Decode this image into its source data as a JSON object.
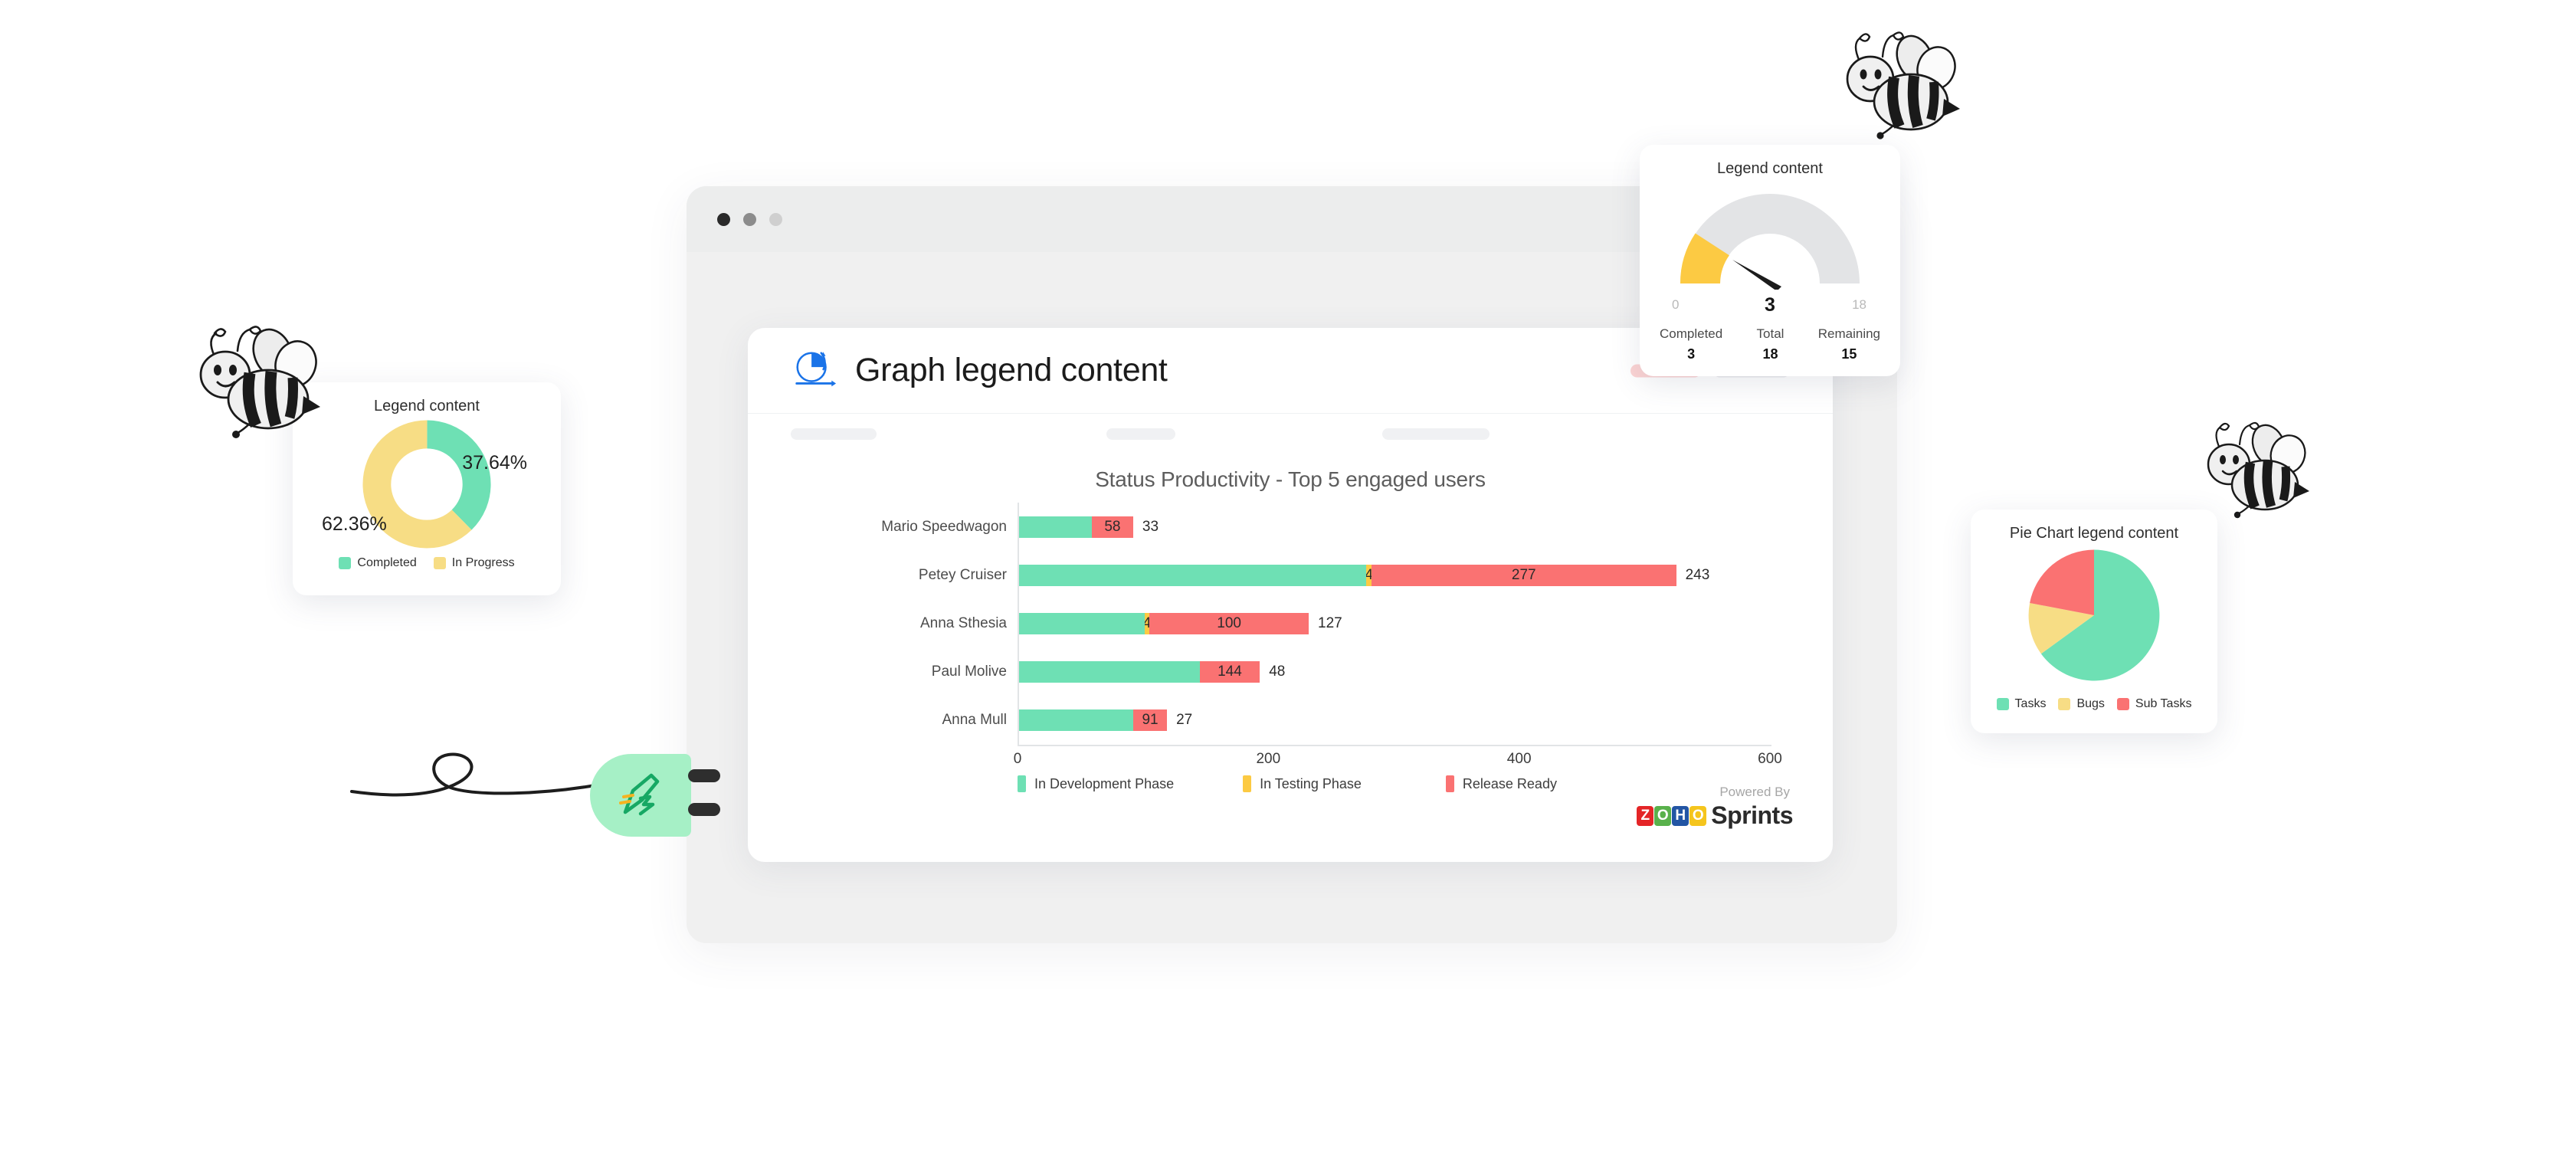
{
  "browser": {
    "dots": [
      "window-dot-close",
      "window-dot-minimize",
      "window-dot-maximize"
    ]
  },
  "dashboard": {
    "logo_icon": "pie-chart-refresh-icon",
    "title": "Graph legend content",
    "header_skeletons": [
      "skeleton-pill-pink",
      "skeleton-pill-gray"
    ],
    "subheader_skeletons": [
      "skeleton-bar-1",
      "skeleton-bar-2",
      "skeleton-bar-3"
    ],
    "powered_by": {
      "label": "Powered By",
      "brand_blocks": [
        "Z",
        "O",
        "H",
        "O"
      ],
      "brand_word": "Sprints"
    }
  },
  "chart_data": {
    "type": "bar",
    "orientation": "horizontal",
    "stacked": true,
    "title": "Status Productivity - Top 5 engaged users",
    "xlabel": "",
    "ylabel": "",
    "xlim": [
      0,
      600
    ],
    "xticks": [
      0,
      200,
      400,
      600
    ],
    "grid": false,
    "legend_position": "bottom",
    "categories": [
      "Mario Speedwagon",
      "Petey Cruiser",
      "Anna Sthesia",
      "Paul Molive",
      "Anna Mull"
    ],
    "series": [
      {
        "name": "In Development Phase",
        "color": "#6ee0b4",
        "values": [
          58,
          277,
          4,
          144,
          91
        ]
      },
      {
        "name": "In Testing Phase",
        "color": "#fcca43",
        "values": [
          0,
          4,
          4,
          0,
          0
        ]
      },
      {
        "name": "Release Ready",
        "color": "#fa7272",
        "values": [
          33,
          243,
          100,
          48,
          27
        ]
      }
    ],
    "bars": [
      {
        "category": "Mario Speedwagon",
        "segments": [
          {
            "series": "In Development Phase",
            "value": 58,
            "label": "",
            "color": "#6ee0b4"
          },
          {
            "series": "Release Ready",
            "value": 33,
            "label": "58",
            "color": "#fa7272"
          }
        ],
        "outer_label": "33"
      },
      {
        "category": "Petey Cruiser",
        "segments": [
          {
            "series": "In Development Phase",
            "value": 277,
            "label": "",
            "color": "#6ee0b4"
          },
          {
            "series": "In Testing Phase",
            "value": 4,
            "label": "4",
            "color": "#fcca43"
          },
          {
            "series": "Release Ready",
            "value": 243,
            "label": "277",
            "color": "#fa7272"
          }
        ],
        "outer_label": "243"
      },
      {
        "category": "Anna Sthesia",
        "segments": [
          {
            "series": "In Development Phase",
            "value": 100,
            "label": "",
            "color": "#6ee0b4"
          },
          {
            "series": "In Testing Phase",
            "value": 4,
            "label": "4",
            "color": "#fcca43"
          },
          {
            "series": "Release Ready",
            "value": 127,
            "label": "100",
            "color": "#fa7272"
          }
        ],
        "outer_label": "127"
      },
      {
        "category": "Paul Molive",
        "segments": [
          {
            "series": "In Development Phase",
            "value": 144,
            "label": "",
            "color": "#6ee0b4"
          },
          {
            "series": "Release Ready",
            "value": 48,
            "label": "144",
            "color": "#fa7272"
          }
        ],
        "outer_label": "48"
      },
      {
        "category": "Anna Mull",
        "segments": [
          {
            "series": "In Development Phase",
            "value": 91,
            "label": "",
            "color": "#6ee0b4"
          },
          {
            "series": "Release Ready",
            "value": 27,
            "label": "91",
            "color": "#fa7272"
          }
        ],
        "outer_label": "27"
      }
    ]
  },
  "donut_card": {
    "title": "Legend content",
    "chart_data": {
      "type": "pie",
      "donut": true,
      "title": "Legend content",
      "labels": [
        "Completed",
        "In Progress"
      ],
      "values": [
        37.64,
        62.36
      ],
      "colors": [
        "#6ee0b4",
        "#f7dd85"
      ],
      "value_labels": [
        "37.64%",
        "62.36%"
      ],
      "legend_position": "bottom"
    }
  },
  "gauge_card": {
    "title": "Legend content",
    "chart_data": {
      "type": "gauge",
      "title": "Legend content",
      "min": 0,
      "max": 18,
      "value": 3,
      "min_label": "0",
      "max_label": "18",
      "value_label": "3",
      "arc_color": "#fcca43",
      "track_color": "#e3e4e6"
    },
    "stats": [
      {
        "label": "Completed",
        "value": "3"
      },
      {
        "label": "Total",
        "value": "18"
      },
      {
        "label": "Remaining",
        "value": "15"
      }
    ]
  },
  "pie_card": {
    "title": "Pie Chart legend content",
    "chart_data": {
      "type": "pie",
      "donut": false,
      "title": "Pie Chart legend content",
      "labels": [
        "Tasks",
        "Bugs",
        "Sub Tasks"
      ],
      "values": [
        65,
        13,
        22
      ],
      "colors": [
        "#6ee0b4",
        "#f7dd85",
        "#fa7272"
      ],
      "legend_position": "bottom"
    }
  },
  "decorations": {
    "bees": [
      "bee-illustration-left",
      "bee-illustration-top-right",
      "bee-illustration-right"
    ],
    "squiggle": "squiggle-line",
    "plug_badge": {
      "icon": "pencil-icon",
      "pins": 2
    }
  }
}
